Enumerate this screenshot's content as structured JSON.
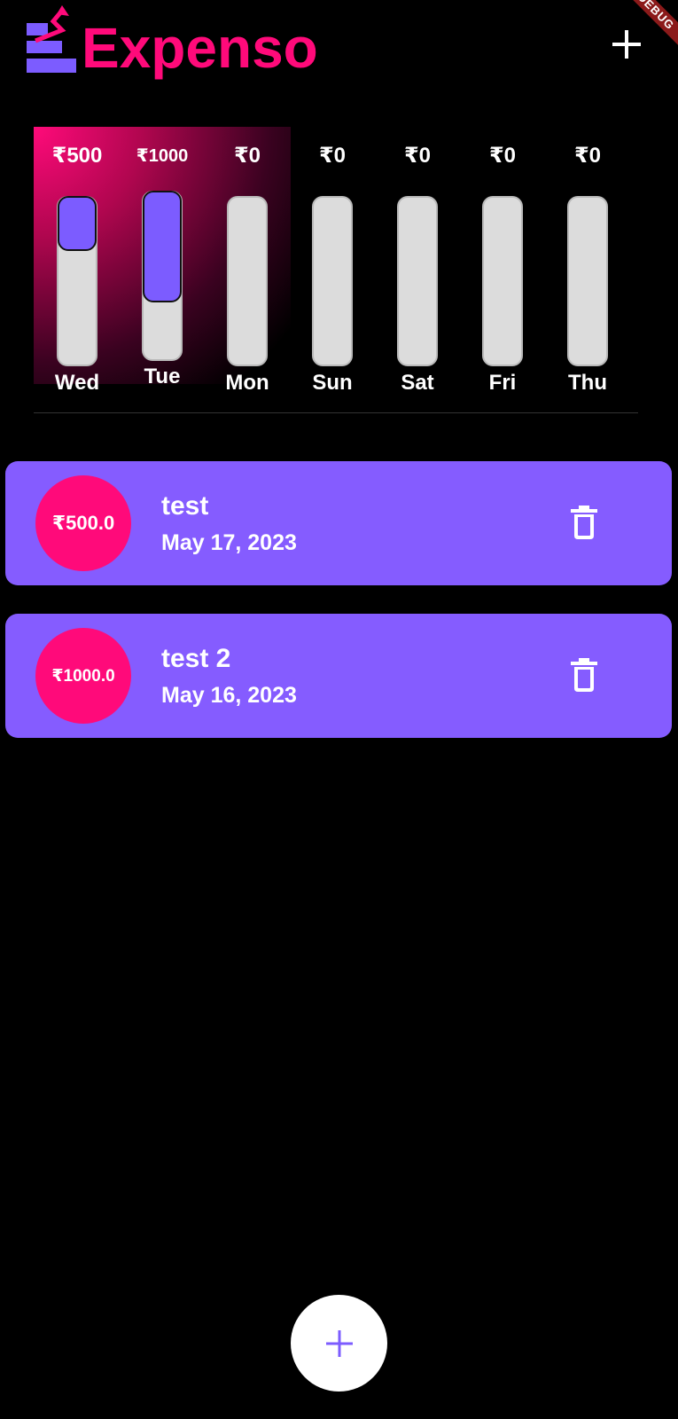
{
  "app": {
    "title": "Expenso",
    "brand_color": "#ff0a7a",
    "accent_color": "#855cff",
    "debug_banner": "DEBUG"
  },
  "header": {
    "add_icon": "plus-icon"
  },
  "chart": {
    "days": [
      {
        "day": "Wed",
        "amount": "₹500",
        "fill_fraction": 0.33
      },
      {
        "day": "Tue",
        "amount": "₹1000",
        "fill_fraction": 0.67
      },
      {
        "day": "Mon",
        "amount": "₹0",
        "fill_fraction": 0
      },
      {
        "day": "Sun",
        "amount": "₹0",
        "fill_fraction": 0
      },
      {
        "day": "Sat",
        "amount": "₹0",
        "fill_fraction": 0
      },
      {
        "day": "Fri",
        "amount": "₹0",
        "fill_fraction": 0
      },
      {
        "day": "Thu",
        "amount": "₹0",
        "fill_fraction": 0
      }
    ]
  },
  "expenses": [
    {
      "amount": "₹500.0",
      "title": "test",
      "date": "May 17, 2023",
      "delete_icon": "trash-icon"
    },
    {
      "amount": "₹1000.0",
      "title": "test 2",
      "date": "May 16, 2023",
      "delete_icon": "trash-icon"
    }
  ],
  "fab": {
    "icon": "plus-icon",
    "icon_color": "#7c5cff"
  }
}
